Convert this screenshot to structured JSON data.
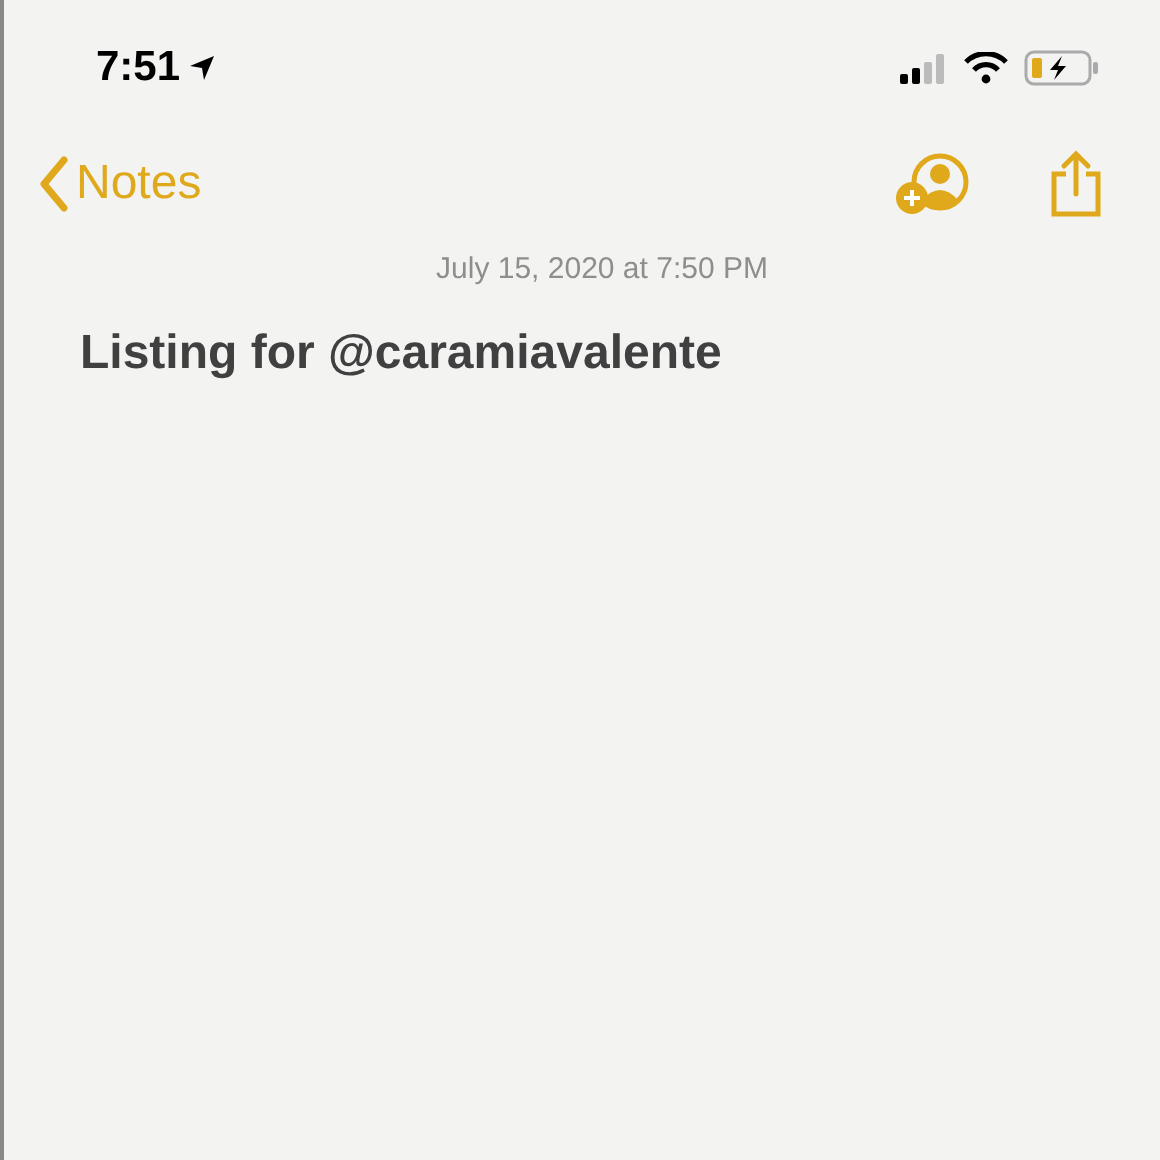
{
  "status_bar": {
    "time": "7:51"
  },
  "nav": {
    "back_label": "Notes"
  },
  "note": {
    "date": "July 15, 2020 at 7:50 PM",
    "title": "Listing for @caramiavalente"
  }
}
